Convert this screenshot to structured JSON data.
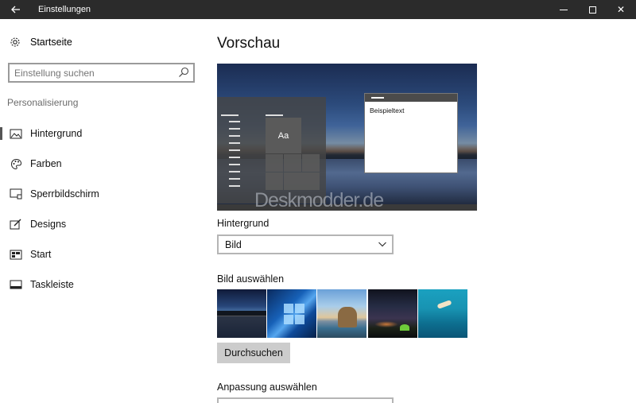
{
  "window": {
    "title": "Einstellungen",
    "back_icon": "arrow-left-icon",
    "controls": [
      "minimize-icon",
      "maximize-icon",
      "close-icon"
    ],
    "close_glyph": "✕"
  },
  "sidebar": {
    "home_label": "Startseite",
    "search": {
      "placeholder": "Einstellung suchen"
    },
    "section": "Personalisierung",
    "items": [
      {
        "label": "Hintergrund",
        "icon": "picture-icon",
        "active": true
      },
      {
        "label": "Farben",
        "icon": "palette-icon",
        "active": false
      },
      {
        "label": "Sperrbildschirm",
        "icon": "lock-screen-icon",
        "active": false
      },
      {
        "label": "Designs",
        "icon": "brush-icon",
        "active": false
      },
      {
        "label": "Start",
        "icon": "start-tiles-icon",
        "active": false
      },
      {
        "label": "Taskleiste",
        "icon": "taskbar-icon",
        "active": false
      }
    ]
  },
  "main": {
    "heading": "Vorschau",
    "preview": {
      "tile_text": "Aa",
      "window_text": "Beispieltext",
      "watermark": "Deskmodder.de"
    },
    "background": {
      "label": "Hintergrund",
      "selected": "Bild"
    },
    "choose_image": {
      "label": "Bild auswählen",
      "thumbnails": [
        "lake-dusk",
        "windows-hero",
        "beach-rocks",
        "night-sky-tent",
        "underwater-diver"
      ]
    },
    "browse_button": "Durchsuchen",
    "fit": {
      "label": "Anpassung auswählen"
    }
  }
}
